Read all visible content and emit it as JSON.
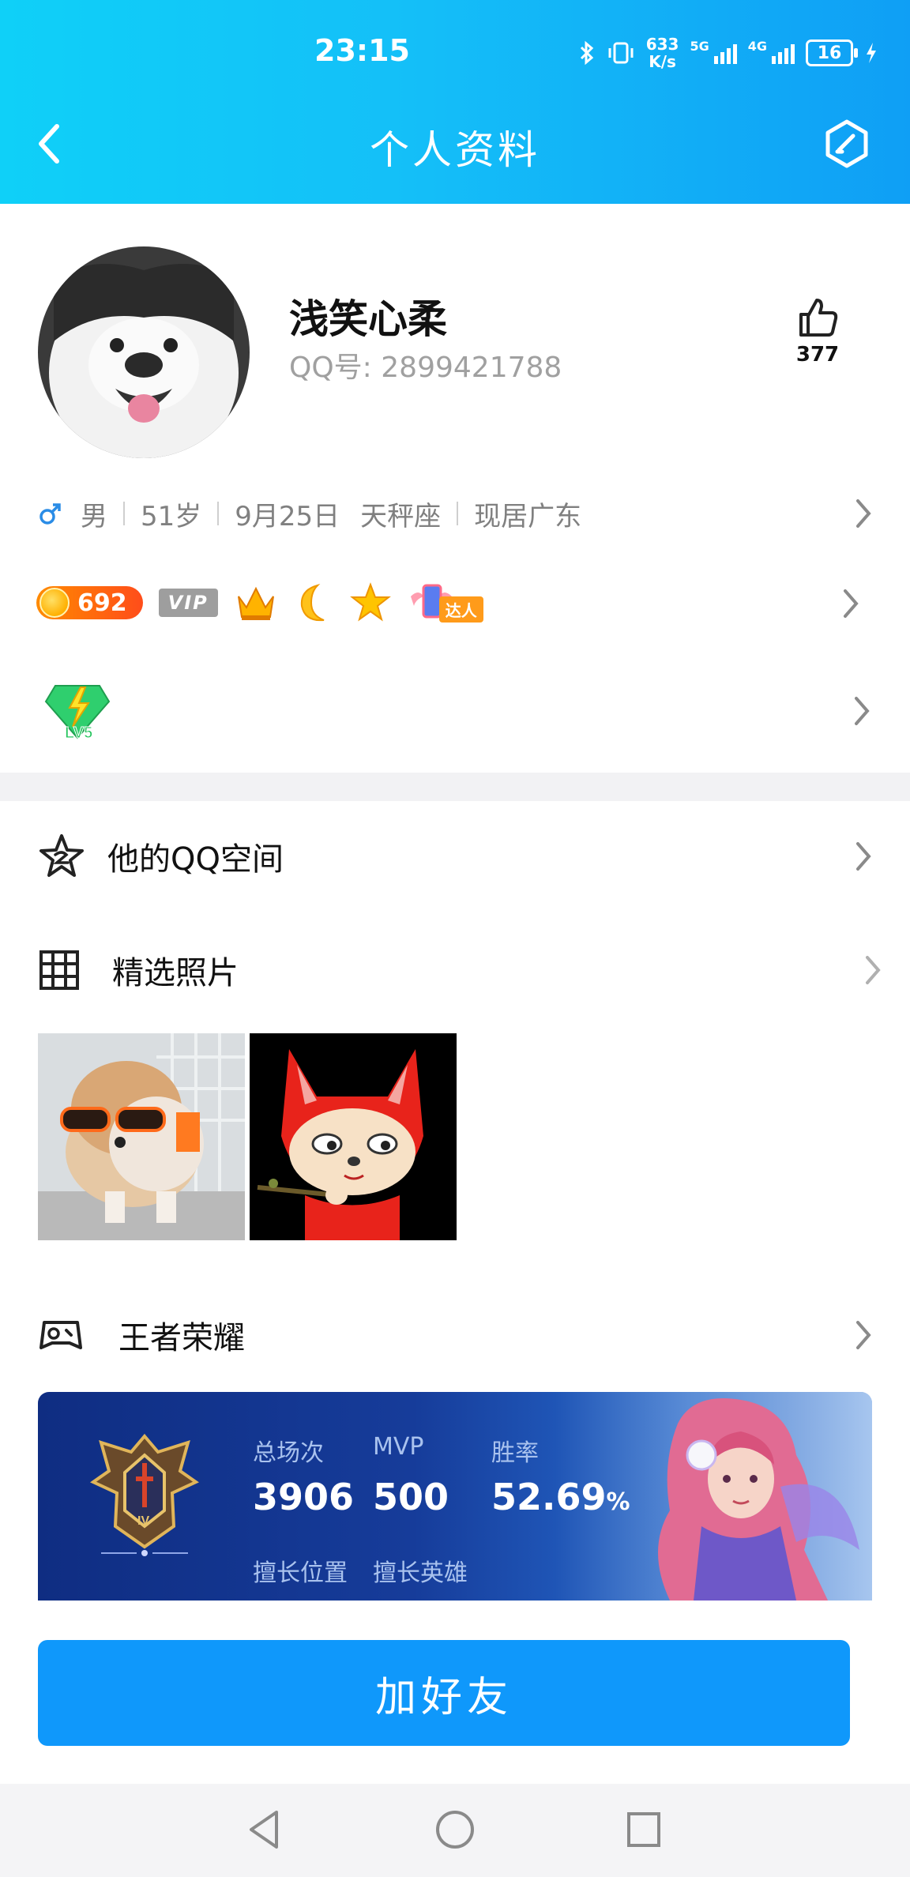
{
  "status_bar": {
    "time": "23:15",
    "net_speed_value": "633",
    "net_speed_unit": "K/s",
    "net_label_1": "5G",
    "net_label_2": "4G",
    "battery": "16",
    "icons": [
      "bluetooth-icon",
      "vibrate-icon",
      "signal-icon",
      "battery-icon",
      "charging-icon"
    ]
  },
  "header": {
    "title": "个人资料",
    "back_icon": "chevron-left-icon",
    "edit_icon": "edit-profile-icon",
    "colors": {
      "gradient_start": "#0fd0f8",
      "gradient_end": "#0f9ff5"
    }
  },
  "profile": {
    "nickname": "浅笑心柔",
    "qq_label": "QQ号:",
    "qq_number": "2899421788",
    "like_count": "377",
    "like_icon": "thumbs-up-icon",
    "avatar_icon": "husky-dog-avatar"
  },
  "info": {
    "gender_icon": "male-icon",
    "gender": "男",
    "age": "51岁",
    "birthday": "9月25日",
    "zodiac": "天秤座",
    "location": "现居广东"
  },
  "badges": {
    "coin_value": "692",
    "vip": "VIP",
    "icons": [
      "crown-icon",
      "moon-icon",
      "star-icon"
    ],
    "expert_label": "达人",
    "level_label": "LV5"
  },
  "menu": {
    "qzone": {
      "label": "他的QQ空间",
      "icon": "qzone-star-icon"
    },
    "photos": {
      "label": "精选照片",
      "icon": "grid-icon"
    },
    "game": {
      "label": "王者荣耀",
      "icon": "gamepad-icon"
    }
  },
  "game_card": {
    "total_label": "总场次",
    "total_value": "3906",
    "mvp_label": "MVP",
    "mvp_value": "500",
    "winrate_label": "胜率",
    "winrate_value": "52.69",
    "winrate_unit": "%",
    "position_label": "擅长位置",
    "hero_label": "擅长英雄",
    "rank_badge_label": "IV"
  },
  "actions": {
    "add_friend": "加好友"
  },
  "system_nav": [
    "back-triangle-icon",
    "home-circle-icon",
    "recents-square-icon"
  ]
}
